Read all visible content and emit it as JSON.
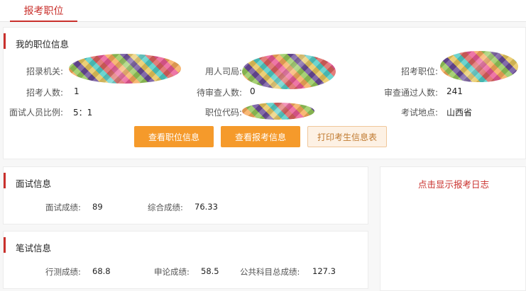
{
  "tab": {
    "label": "报考职位"
  },
  "info": {
    "title": "我的职位信息",
    "fields": [
      {
        "label": "招录机关:",
        "value": ""
      },
      {
        "label": "用人司局:",
        "value": ""
      },
      {
        "label": "招考职位:",
        "value": ""
      },
      {
        "label": "招考人数:",
        "value": "1"
      },
      {
        "label": "待审查人数:",
        "value": "0"
      },
      {
        "label": "审查通过人数:",
        "value": "241"
      },
      {
        "label": "面试人员比例:",
        "value": "5：1"
      },
      {
        "label": "职位代码:",
        "value": ""
      },
      {
        "label": "考试地点:",
        "value": "山西省"
      }
    ],
    "buttons": {
      "view_position": "查看职位信息",
      "view_application": "查看报考信息",
      "print": "打印考生信息表"
    }
  },
  "interview": {
    "title": "面试信息",
    "scores": [
      {
        "label": "面试成绩:",
        "value": "89"
      },
      {
        "label": "综合成绩:",
        "value": "76.33"
      }
    ]
  },
  "written": {
    "title": "笔试信息",
    "scores": [
      {
        "label": "行测成绩:",
        "value": "68.8"
      },
      {
        "label": "申论成绩:",
        "value": "58.5"
      },
      {
        "label": "公共科目总成绩:",
        "value": "127.3"
      }
    ]
  },
  "log": {
    "link": "点击显示报考日志"
  },
  "colors": {
    "accent": "#c9302c",
    "button": "#f59a2b"
  }
}
